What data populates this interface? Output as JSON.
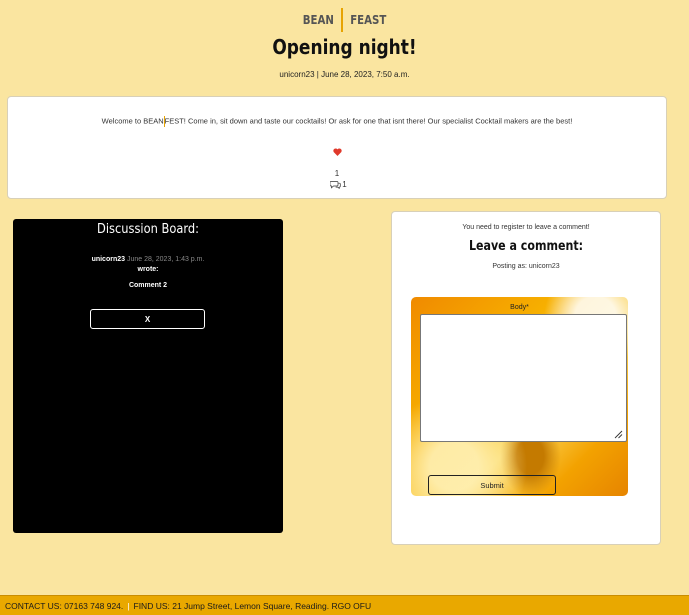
{
  "brand": {
    "left": "BEAN",
    "right": "FEAST"
  },
  "post": {
    "title": "Opening night!",
    "meta": "unicorn23 | June 28, 2023, 7:50 a.m.",
    "body_start": "Welcome to BEAN",
    "body_end": "FEST! Come in, sit down and taste our cocktails! Or ask for one that isnt there! Our specialist Cocktail makers are the best!",
    "like_count": "1",
    "comment_count": "1"
  },
  "discussion": {
    "heading": "Discussion Board:",
    "comments": [
      {
        "author": "unicorn23",
        "date": "June 28, 2023, 1:43 p.m.",
        "wrote": "wrote:",
        "text": "Comment 2",
        "delete_label": "X"
      }
    ]
  },
  "comment_form": {
    "register_note": "You need to register to leave a comment!",
    "heading": "Leave a comment:",
    "posting_as": "Posting as: unicorn23",
    "body_label": "Body*",
    "body_value": "",
    "submit_label": "Submit"
  },
  "footer": {
    "contact": "CONTACT US: 07163 748 924.",
    "find": "FIND US: 21 Jump Street, Lemon Square, Reading. RGO OFU"
  },
  "colors": {
    "background": "#fae5a0",
    "accent": "#e9a800",
    "heart": "#e0392b"
  },
  "icons": [
    "heart-icon",
    "comment-icon",
    "resize-grip-icon"
  ]
}
